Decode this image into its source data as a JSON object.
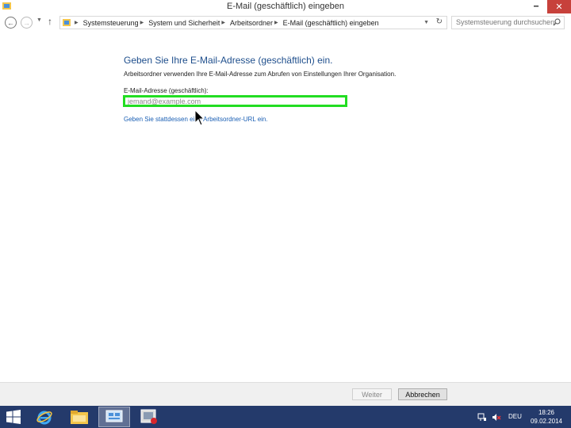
{
  "window": {
    "title": "E-Mail (geschäftlich) eingeben",
    "minimize_glyph": "🗕",
    "maximize_glyph": "🗗",
    "close_glyph": "✕"
  },
  "nav": {
    "back_glyph": "←",
    "forward_glyph": "→",
    "dropdown_glyph": "▼",
    "up_glyph": "↑",
    "breadcrumbs": [
      "Systemsteuerung",
      "System und Sicherheit",
      "Arbeitsordner",
      "E-Mail (geschäftlich) eingeben"
    ],
    "breadcrumb_separator": "▶",
    "refresh_glyph": "↻",
    "search_placeholder": "Systemsteuerung durchsuchen"
  },
  "content": {
    "heading": "Geben Sie Ihre E-Mail-Adresse (geschäftlich) ein.",
    "description": "Arbeitsordner verwenden Ihre E-Mail-Adresse zum Abrufen von Einstellungen Ihrer Organisation.",
    "email_label": "E-Mail-Adresse (geschäftlich):",
    "email_placeholder": "jemand@example.com",
    "email_value": "",
    "url_link": "Geben Sie stattdessen eine Arbeitsordner-URL ein."
  },
  "footer": {
    "next_label": "Weiter",
    "cancel_label": "Abbrechen"
  },
  "taskbar": {
    "language": "DEU",
    "time": "18:26",
    "date": "09.02.2014"
  },
  "colors": {
    "heading": "#1e4e8c",
    "link": "#1a5fb4",
    "highlight": "#22dd22",
    "close_button": "#c7413b",
    "taskbar": "#243a6b"
  }
}
